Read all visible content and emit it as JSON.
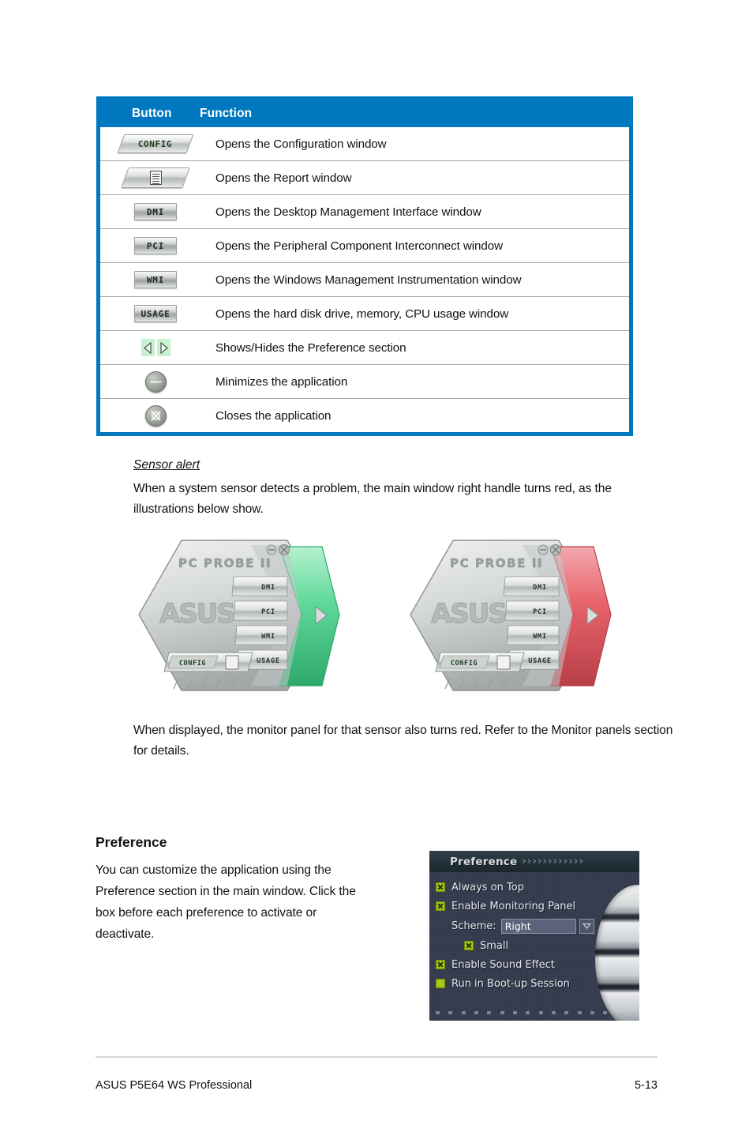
{
  "table": {
    "headers": {
      "button": "Button",
      "function": "Function"
    },
    "rows": [
      {
        "icon": "config-button-icon",
        "icon_kind": "config",
        "icon_label": "CONFIG",
        "function": "Opens the Configuration window"
      },
      {
        "icon": "report-button-icon",
        "icon_kind": "report",
        "icon_label": "",
        "function": "Opens the Report window"
      },
      {
        "icon": "dmi-button-icon",
        "icon_kind": "silver",
        "icon_label": "DMI",
        "function": "Opens the Desktop Management Interface window"
      },
      {
        "icon": "pci-button-icon",
        "icon_kind": "silver",
        "icon_label": "PCI",
        "function": "Opens the Peripheral Component Interconnect window"
      },
      {
        "icon": "wmi-button-icon",
        "icon_kind": "silver",
        "icon_label": "WMI",
        "function": "Opens the Windows Management Instrumentation window"
      },
      {
        "icon": "usage-button-icon",
        "icon_kind": "silver",
        "icon_label": "USAGE",
        "function": "Opens the hard disk drive, memory, CPU usage window"
      },
      {
        "icon": "show-hide-arrows-icon",
        "icon_kind": "arrows",
        "icon_label": "",
        "function": "Shows/Hides the Preference section"
      },
      {
        "icon": "minimize-button-icon",
        "icon_kind": "minimize",
        "icon_label": "",
        "function": "Minimizes the application"
      },
      {
        "icon": "close-button-icon",
        "icon_kind": "close",
        "icon_label": "",
        "function": "Closes the application"
      }
    ]
  },
  "sensor_alert": {
    "heading": "Sensor alert",
    "body": "When a system sensor detects a problem, the main window right handle turns red, as the illustrations below show."
  },
  "illustrations": {
    "app_title": "PC PROBE II",
    "logo": "ASUS",
    "side_buttons": [
      "DMI",
      "PCI",
      "WMI",
      "USAGE"
    ],
    "config_label": "CONFIG",
    "left": {
      "name": "pc-probe-normal",
      "handle_color": "#5fd99a"
    },
    "right": {
      "name": "pc-probe-alert",
      "handle_color": "#e8636b"
    }
  },
  "monitor_note": "When displayed, the monitor panel for that sensor also turns red. Refer to the Monitor panels section for details.",
  "preference": {
    "heading": "Preference",
    "body": "You can customize the application using the Preference section in the main window. Click the box before each preference to activate or deactivate.",
    "panel": {
      "title": "Preference",
      "chevrons": "››››››››››››",
      "items": [
        {
          "label": "Always on Top",
          "checked": true,
          "indent": 0
        },
        {
          "label": "Enable Monitoring Panel",
          "checked": true,
          "indent": 0
        },
        {
          "label": "Small",
          "checked": true,
          "indent": 2
        },
        {
          "label": "Enable Sound Effect",
          "checked": true,
          "indent": 0
        },
        {
          "label": "Run in Boot-up Session",
          "checked": false,
          "indent": 0
        }
      ],
      "scheme": {
        "label": "Scheme:",
        "value": "Right"
      }
    }
  },
  "footer": {
    "left": "ASUS P5E64 WS Professional",
    "right": "5-13"
  },
  "colors": {
    "table_header_blue": "#0078bf",
    "row_divider": "#a6a6a6",
    "alert_red": "#e8636b",
    "ok_green": "#5fd99a",
    "checkbox_green": "#a8c814",
    "panel_dark": "#343b4d"
  }
}
